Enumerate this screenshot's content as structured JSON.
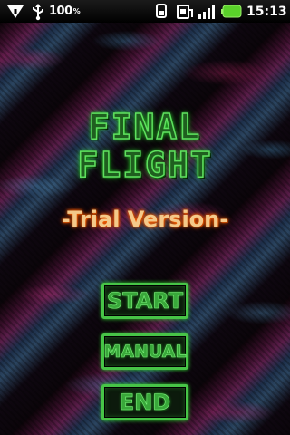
{
  "status_bar": {
    "battery_percent_text": "100",
    "clock": "15:13",
    "icons": [
      "usb-debug-icon",
      "usb-icon",
      "battery-percent-icon",
      "wifi-icon",
      "sim-icon",
      "signal-icon",
      "battery-icon"
    ]
  },
  "game": {
    "title_line1": "FINAL",
    "title_line2": "FLIGHT",
    "subtitle": "-Trial Version-",
    "menu": {
      "start_label": "START",
      "manual_label": "MANUAL",
      "end_label": "END"
    }
  },
  "colors": {
    "title_green": "#5ee05e",
    "button_border": "#47c447",
    "subtitle_orange": "#f4c98a"
  }
}
